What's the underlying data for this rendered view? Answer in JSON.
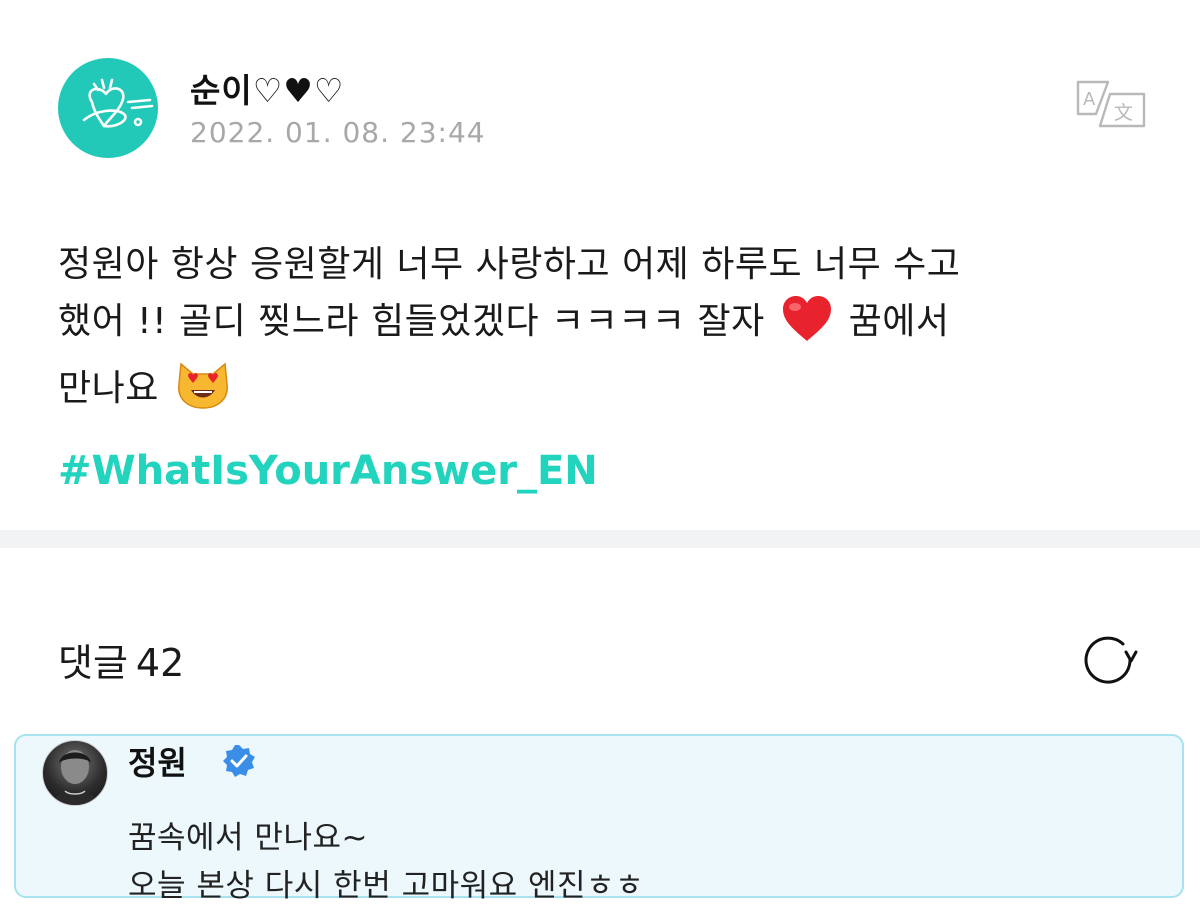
{
  "post": {
    "author_name": "순이♡♥♡",
    "timestamp": "2022. 01. 08. 23:44",
    "body_line1": "정원아 항상 응원할게 너무 사랑하고 어제 하루도 너무 수고",
    "body_line2_before_emoji": "했어 !! 골디 찢느라 힘들었겠다 ㅋㅋㅋㅋ 잘자",
    "body_line2_after_emoji": "꿈에서",
    "body_line3": "만나요",
    "hashtag": "#WhatIsYourAnswer_EN",
    "translate_icon": "translate-icon",
    "heart_emoji_icon": "red-heart-icon",
    "cat_emoji_icon": "heart-eyes-cat-icon"
  },
  "comments": {
    "label": "댓글",
    "count": "42",
    "refresh_icon": "refresh-icon"
  },
  "artist_comment": {
    "name": "정원",
    "verified_icon": "verified-badge-icon",
    "line1": "꿈속에서 만나요~",
    "line2": "오늘 본상 다시 한번 고마워요 엔진ㅎㅎ"
  },
  "colors": {
    "accent": "#22d3bd",
    "timestamp": "#a8a8a8",
    "divider": "#f2f3f5",
    "artist_bg": "#edf8fd",
    "artist_border": "#a8e2f0",
    "verified": "#3a8ee8"
  }
}
